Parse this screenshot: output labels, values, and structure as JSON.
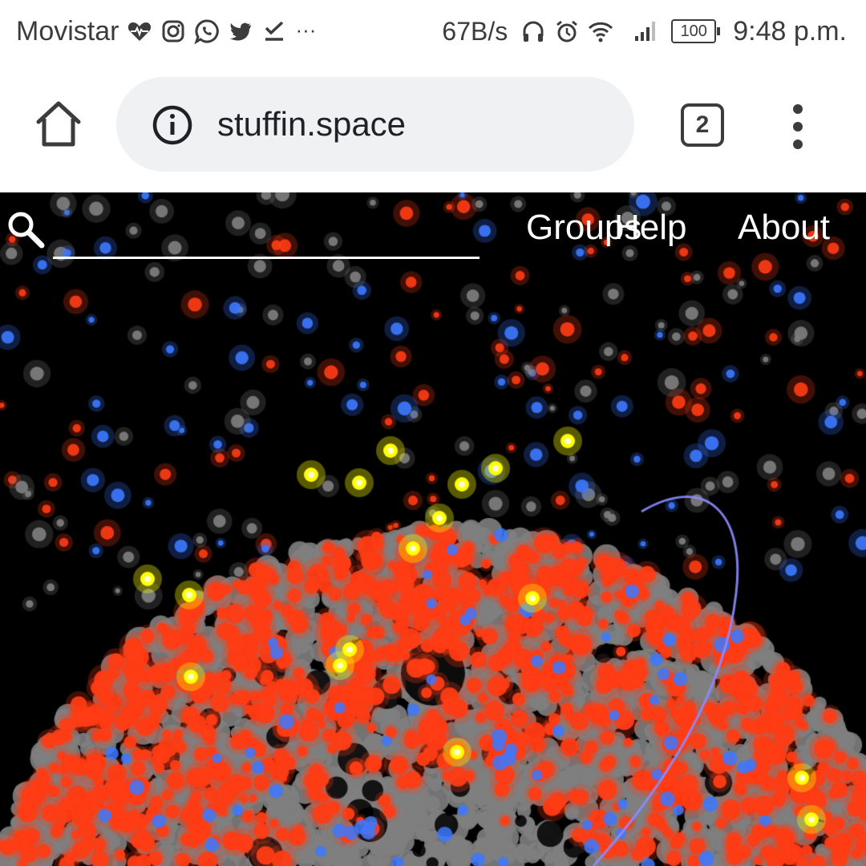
{
  "status_bar": {
    "carrier": "Movistar",
    "notification_icons": [
      "heart-pulse-icon",
      "instagram-icon",
      "whatsapp-icon",
      "twitter-icon",
      "checkmark-icon",
      "more-dots-icon"
    ],
    "more": "···",
    "net_speed": "67B/s",
    "system_icons": [
      "headphones-icon",
      "alarm-icon",
      "wifi-icon",
      "signal-icon"
    ],
    "battery": "100",
    "time": "9:48 p.m."
  },
  "browser": {
    "url": "stuffin.space",
    "tab_count": "2"
  },
  "page": {
    "search": {
      "placeholder": "",
      "value": ""
    },
    "nav": {
      "groups": "Groups",
      "help": "Help",
      "about": "About"
    },
    "colors": {
      "background": "#000000",
      "debris": "#808080",
      "rocket_body": "#ff3c14",
      "payload": "#ffff00",
      "unknown": "#3c78ff",
      "orbit_line": "#8c8cff"
    }
  }
}
